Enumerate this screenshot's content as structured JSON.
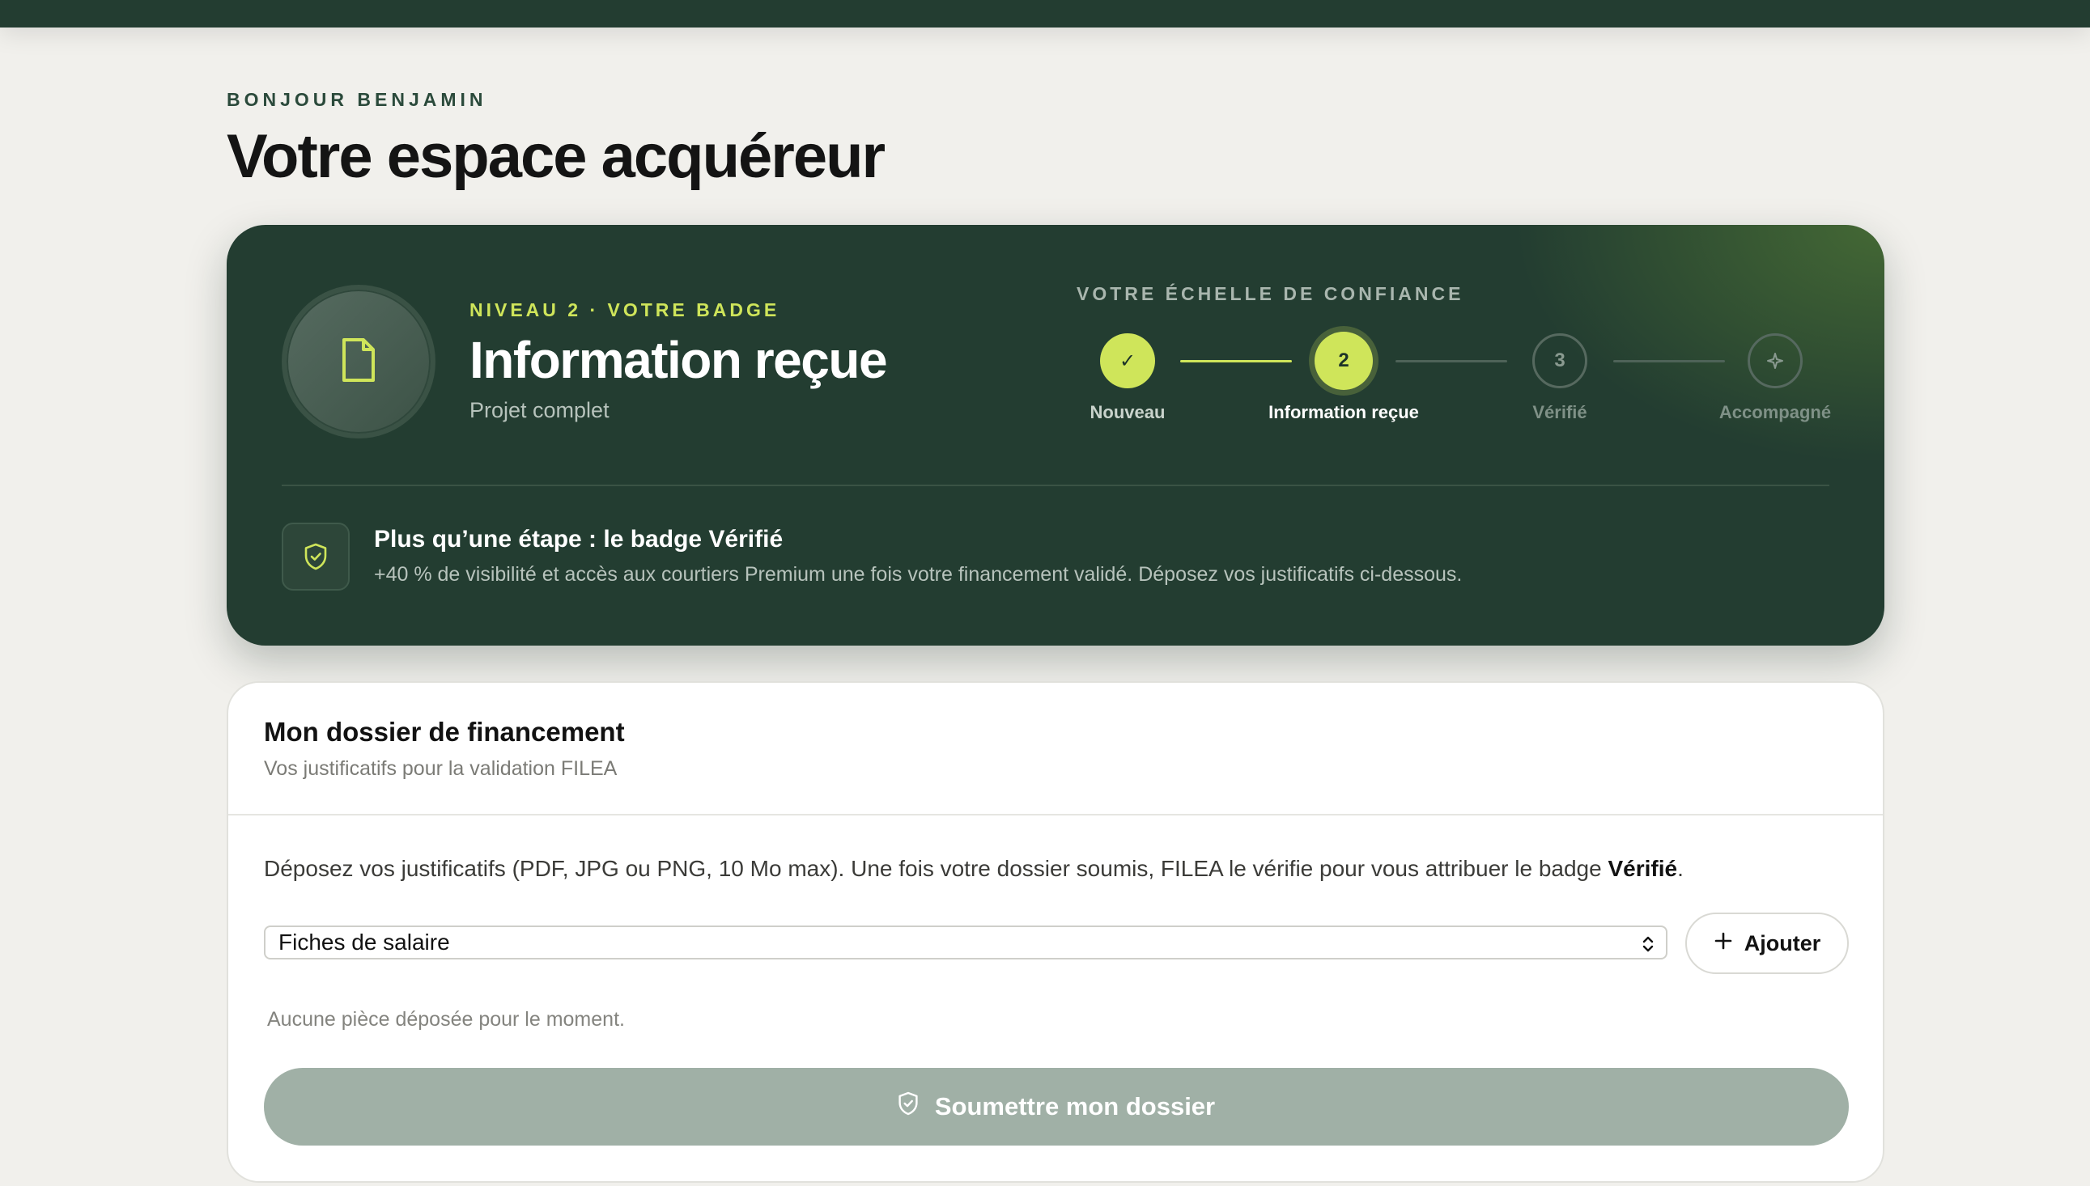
{
  "header": {
    "greeting": "BONJOUR BENJAMIN",
    "title": "Votre espace acquéreur"
  },
  "badge": {
    "icon": "document-icon",
    "level": "NIVEAU 2 · VOTRE BADGE",
    "title": "Information reçue",
    "subtitle": "Projet complet"
  },
  "trust_scale": {
    "label": "VOTRE ÉCHELLE DE CONFIANCE",
    "steps": [
      {
        "marker": "✓",
        "label": "Nouveau",
        "state": "done"
      },
      {
        "marker": "2",
        "label": "Information reçue",
        "state": "active"
      },
      {
        "marker": "3",
        "label": "Vérifié",
        "state": "todo"
      },
      {
        "marker": "sparkle-icon",
        "label": "Accompagné",
        "state": "todo"
      }
    ]
  },
  "tip": {
    "icon": "shield-check-icon",
    "title": "Plus qu’une étape : le badge Vérifié",
    "text": "+40 % de visibilité et accès aux courtiers Premium une fois votre financement validé. Déposez vos justificatifs ci-dessous."
  },
  "dossier": {
    "title": "Mon dossier de financement",
    "subtitle": "Vos justificatifs pour la validation FILEA",
    "info_prefix": "Déposez vos justificatifs (PDF, JPG ou PNG, 10 Mo max). Une fois votre dossier soumis, FILEA le vérifie pour vous attribuer le badge ",
    "info_bold": "Vérifié",
    "info_suffix": ".",
    "document_type": "Fiches de salaire",
    "add_label": "Ajouter",
    "empty_text": "Aucune pièce déposée pour le moment.",
    "submit_label": "Soumettre mon dossier"
  },
  "colors": {
    "brand_dark": "#233d31",
    "accent": "#cfe55a",
    "submit_disabled": "#a0b0a6",
    "page_bg": "#f1f0ec"
  }
}
